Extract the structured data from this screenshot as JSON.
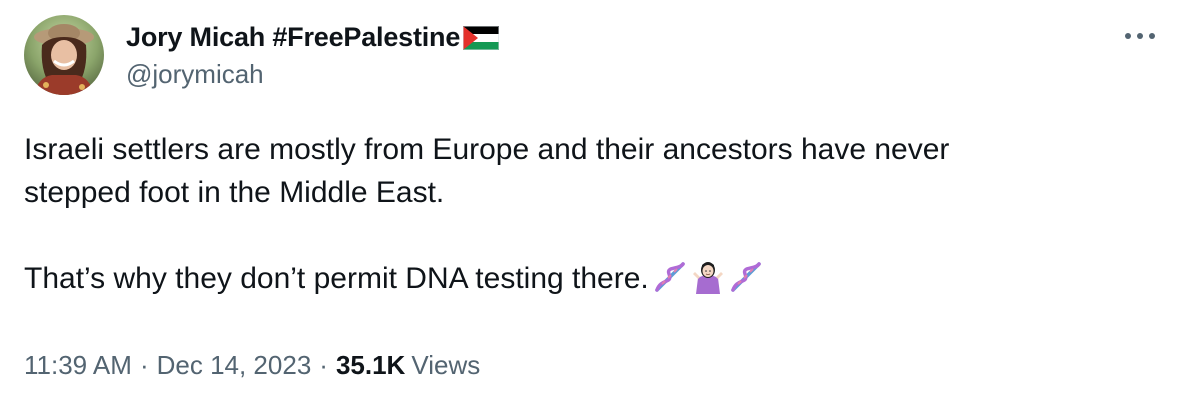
{
  "author": {
    "display_name": "Jory Micah #FreePalestine",
    "flag_icon": "palestine-flag-icon",
    "handle": "@jorymicah",
    "avatar_icon": "user-avatar-photo"
  },
  "more_icon": "more-horizontal-icon",
  "tweet": {
    "line1": "Israeli settlers are mostly from Europe and their ancestors have never",
    "line2": "stepped foot in the Middle East.",
    "line3": "That’s why they don’t permit DNA testing there.",
    "emojis": [
      "dna-icon",
      "person-shrugging-icon",
      "dna-icon"
    ]
  },
  "meta": {
    "time": "11:39 AM",
    "separator": "·",
    "date": "Dec 14, 2023",
    "views_count": "35.1K",
    "views_label": "Views"
  },
  "colors": {
    "text_primary": "#0f1419",
    "text_secondary": "#536471",
    "flag_black": "#000000",
    "flag_white": "#ffffff",
    "flag_green": "#149954",
    "flag_red": "#e4312b",
    "shrug_shirt": "#a66cd0"
  }
}
